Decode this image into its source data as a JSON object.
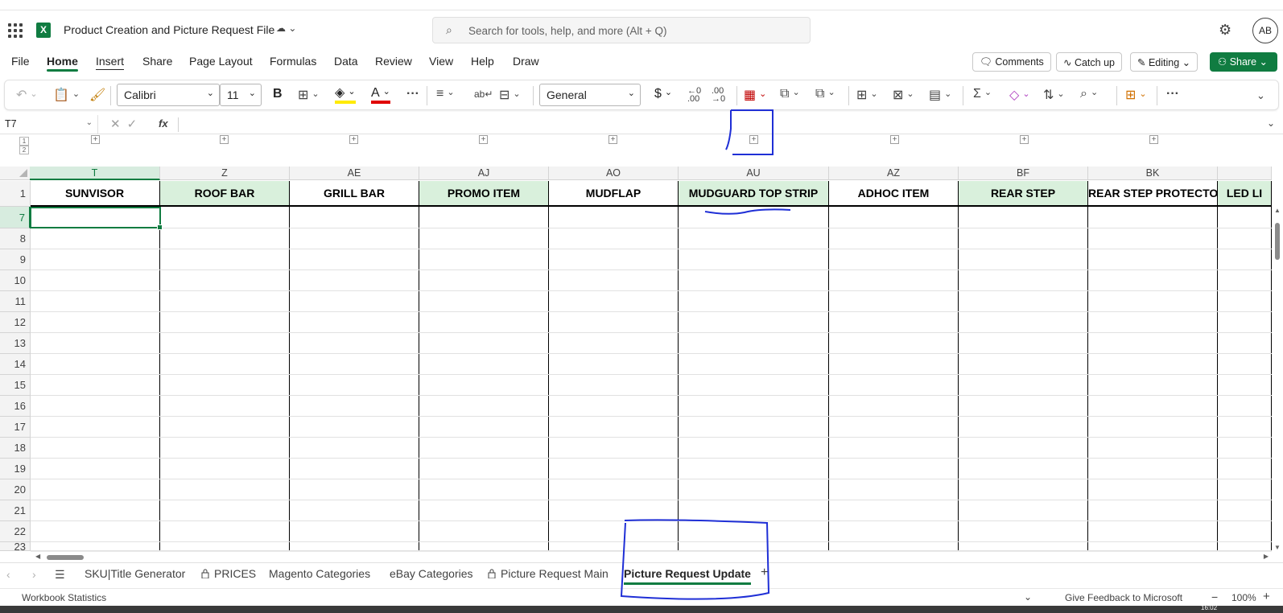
{
  "app": {
    "doc_title": "Product Creation and Picture Request File",
    "search_placeholder": "Search for tools, help, and more (Alt + Q)",
    "avatar_initials": "AB"
  },
  "menu": {
    "file": "File",
    "home": "Home",
    "insert": "Insert",
    "share": "Share",
    "page_layout": "Page Layout",
    "formulas": "Formulas",
    "data": "Data",
    "review": "Review",
    "view": "View",
    "help": "Help",
    "draw": "Draw",
    "comments": "Comments",
    "catch_up": "Catch up",
    "editing": "Editing",
    "share_btn": "Share"
  },
  "ribbon": {
    "font_name": "Calibri",
    "font_size": "11",
    "number_format": "General"
  },
  "formula_bar": {
    "name_box": "T7",
    "fx": "fx",
    "formula": ""
  },
  "outline_levels": [
    "1",
    "2"
  ],
  "columns": [
    {
      "letter": "T",
      "header": "SUNVISOR",
      "green": false,
      "selected": true
    },
    {
      "letter": "Z",
      "header": "ROOF BAR",
      "green": true,
      "selected": false
    },
    {
      "letter": "AE",
      "header": "GRILL BAR",
      "green": false,
      "selected": false
    },
    {
      "letter": "AJ",
      "header": "PROMO ITEM",
      "green": true,
      "selected": false
    },
    {
      "letter": "AO",
      "header": "MUDFLAP",
      "green": false,
      "selected": false
    },
    {
      "letter": "AU",
      "header": "MUDGUARD TOP STRIP",
      "green": true,
      "selected": false
    },
    {
      "letter": "AZ",
      "header": "ADHOC ITEM",
      "green": false,
      "selected": false
    },
    {
      "letter": "BF",
      "header": "REAR STEP",
      "green": true,
      "selected": false
    },
    {
      "letter": "BK",
      "header": "REAR STEP PROTECTOR",
      "green": false,
      "selected": false
    },
    {
      "letter": "",
      "header": "LED LI",
      "green": true,
      "selected": false
    }
  ],
  "rows": [
    "1",
    "7",
    "8",
    "9",
    "10",
    "11",
    "12",
    "13",
    "14",
    "15",
    "16",
    "17",
    "18",
    "19",
    "20",
    "21",
    "22",
    "23"
  ],
  "sheets": [
    "SKU|Title Generator",
    "PRICES",
    "Magento Categories",
    "eBay Categories",
    "Picture Request Main",
    "Picture Request Update"
  ],
  "add_sheet": "+",
  "status": {
    "left": "Workbook Statistics",
    "feedback": "Give Feedback to Microsoft",
    "zoom": "100%",
    "zoom_out": "−",
    "zoom_in": "+"
  },
  "taskbar_time": "16:02",
  "colors": {
    "accent": "#107c41",
    "header_green": "#d9f0dc",
    "annotation": "#1f2fd6"
  }
}
